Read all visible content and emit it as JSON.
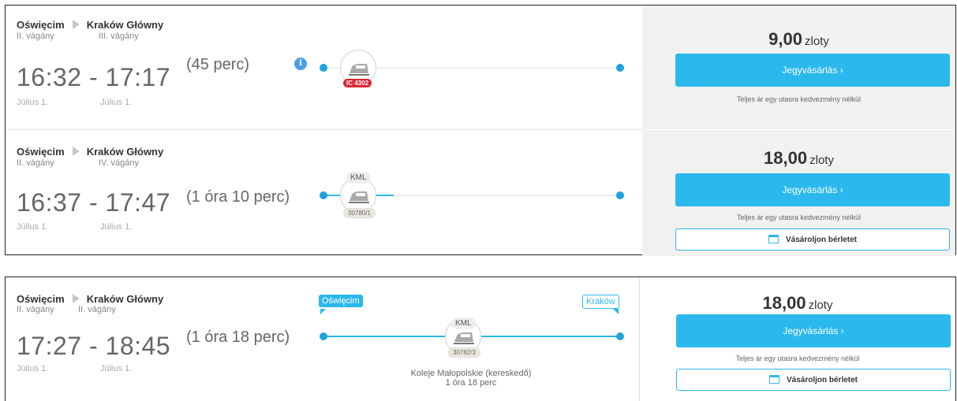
{
  "connections": [
    {
      "from": "Oświęcim",
      "to": "Kraków Główny",
      "from_platform": "II. vágány",
      "to_platform": "III. vágány",
      "times": "16:32 - 17:17",
      "dep_date": "Július 1.",
      "arr_date": "Július 1.",
      "duration": "(45 perc)",
      "info_icon": "i",
      "train_badge": "IC 4302",
      "price_value": "9,00",
      "price_currency": "zloty",
      "buy_label": "Jegyvásárlás  ›",
      "note": "Teljes ár egy utasra kedvezmény nélkül"
    },
    {
      "from": "Oświęcim",
      "to": "Kraków Główny",
      "from_platform": "II. vágány",
      "to_platform": "IV. vágány",
      "times": "16:37 - 17:47",
      "dep_date": "Július 1.",
      "arr_date": "Július 1.",
      "duration": "(1 óra  10 perc)",
      "carrier": "KML",
      "train_badge": "30780/1",
      "price_value": "18,00",
      "price_currency": "zloty",
      "buy_label": "Jegyvásárlás  ›",
      "note": "Teljes ár egy utasra kedvezmény nélkül",
      "pass_label": "Vásároljon bérletet"
    },
    {
      "from": "Oświęcim",
      "to": "Kraków Główny",
      "from_platform": "II. vágány",
      "to_platform": "II. vágány",
      "times": "17:27 - 18:45",
      "dep_date": "Július 1.",
      "arr_date": "Július 1.",
      "duration": "(1 óra  18 perc)",
      "start_flag": "Oświęcim",
      "end_flag": "Kraków",
      "carrier": "KML",
      "train_badge": "30782/3",
      "operator": "Koleje Małopolskie  (kereskedő)",
      "operator_duration": "1 óra  18 perc",
      "price_value": "18,00",
      "price_currency": "zloty",
      "buy_label": "Jegyvásárlás  ›",
      "note": "Teljes ár egy utasra kedvezmény nélkül",
      "pass_label": "Vásároljon bérletet"
    }
  ],
  "colors": {
    "accent": "#2bb8ec",
    "badge_red": "#e02634",
    "price_panel_bg": "#f1f1ef"
  },
  "icons": [
    "info-icon",
    "train-icon",
    "calendar-icon",
    "route-arrow-icon"
  ]
}
